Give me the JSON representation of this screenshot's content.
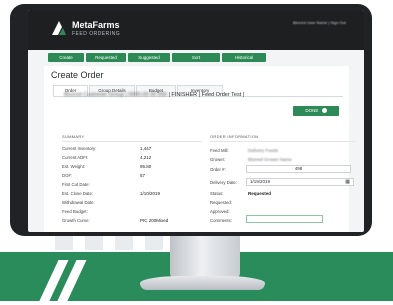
{
  "brand": {
    "name": "MetaFarms",
    "subtitle": "FEED ORDERING"
  },
  "header": {
    "user_info": "Blurred User Name | Sign Out"
  },
  "nav": [
    {
      "label": "Create Order"
    },
    {
      "label": "Requested"
    },
    {
      "label": "Suggested"
    },
    {
      "label": "Sort"
    },
    {
      "label": "Historical"
    }
  ],
  "page": {
    "title": "Create Order",
    "tabs": [
      {
        "label": "Order",
        "active": true
      },
      {
        "label": "Group Details",
        "active": false
      },
      {
        "label": "Budget",
        "active": false
      },
      {
        "label": "Inventory",
        "active": false
      }
    ],
    "done_label": "DONE",
    "order_heading": {
      "blurred_part": "Blurred Customer Group | 0000-00 00 000",
      "text": "| FINISHER | Feed Order Test |"
    }
  },
  "summary": {
    "label": "SUMMARY",
    "rows": [
      {
        "label": "Current Inventory:",
        "value": "1,447"
      },
      {
        "label": "Current ADFI:",
        "value": "4,212"
      },
      {
        "label": "Est. Weight:",
        "value": "95.80"
      },
      {
        "label": "DOF:",
        "value": "57"
      },
      {
        "label": "First Cut Date:",
        "value": ""
      },
      {
        "label": "Est. Close Date:",
        "value": "1/10/2019"
      },
      {
        "label": "Withdrawal Date:",
        "value": ""
      },
      {
        "label": "Feed Budget:",
        "value": ""
      },
      {
        "label": "Growth Curve:",
        "value": "PIC 200Mixed"
      }
    ]
  },
  "order_info": {
    "label": "ORDER INFORMATION",
    "feed_mill": {
      "label": "Feed Mill:",
      "value": "Delivery Feeds"
    },
    "grower": {
      "label": "Grower:",
      "value": "Blurred Grower Name"
    },
    "order_num": {
      "label": "Order #:",
      "value": "498"
    },
    "delivery_date": {
      "label": "Delivery Date:",
      "value": "1/19/2019"
    },
    "status": {
      "label": "Status:",
      "value": "Requested"
    },
    "requested": {
      "label": "Requested:",
      "value": ""
    },
    "approved": {
      "label": "Approved:",
      "value": ""
    },
    "comments": {
      "label": "Comments:",
      "value": ""
    }
  },
  "colors": {
    "accent_green": "#2d8a57",
    "header_dark": "#1d1f21",
    "bezel": "#202225"
  }
}
